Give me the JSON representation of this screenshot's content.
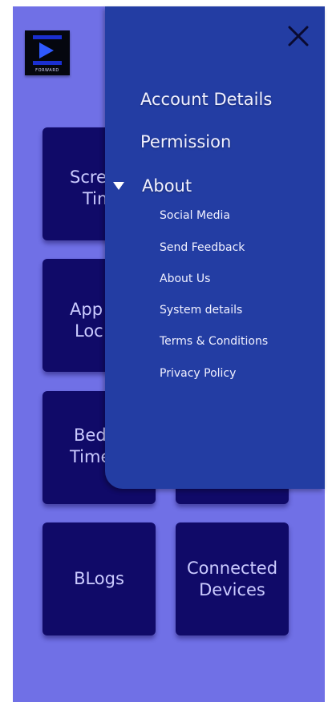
{
  "logo": {
    "wordmark": "FORWARD"
  },
  "tiles": [
    {
      "line1": "Scre",
      "line2": "Tim"
    },
    {
      "line1": "App",
      "line2": "Loc"
    },
    {
      "line1": "Bed",
      "line2": "Time"
    },
    {
      "line1": "BLogs",
      "line2": ""
    },
    {
      "line1": "Connected",
      "line2": "Devices"
    }
  ],
  "menu": {
    "items": {
      "account_details": "Account Details",
      "permission": "Permission",
      "about": "About"
    },
    "about_submenu": {
      "social_media": "Social Media",
      "send_feedback": "Send Feedback",
      "about_us": "About Us",
      "system_details": "System details",
      "terms": "Terms & Conditions",
      "privacy": "Privacy Policy"
    },
    "close_icon": "close-icon",
    "expand_icon": "triangle-down-icon"
  },
  "colors": {
    "background": "#7070e6",
    "tile": "#100a68",
    "tile_text": "#cbcbff",
    "drawer": "#233da3",
    "drawer_text": "#ffffff"
  }
}
